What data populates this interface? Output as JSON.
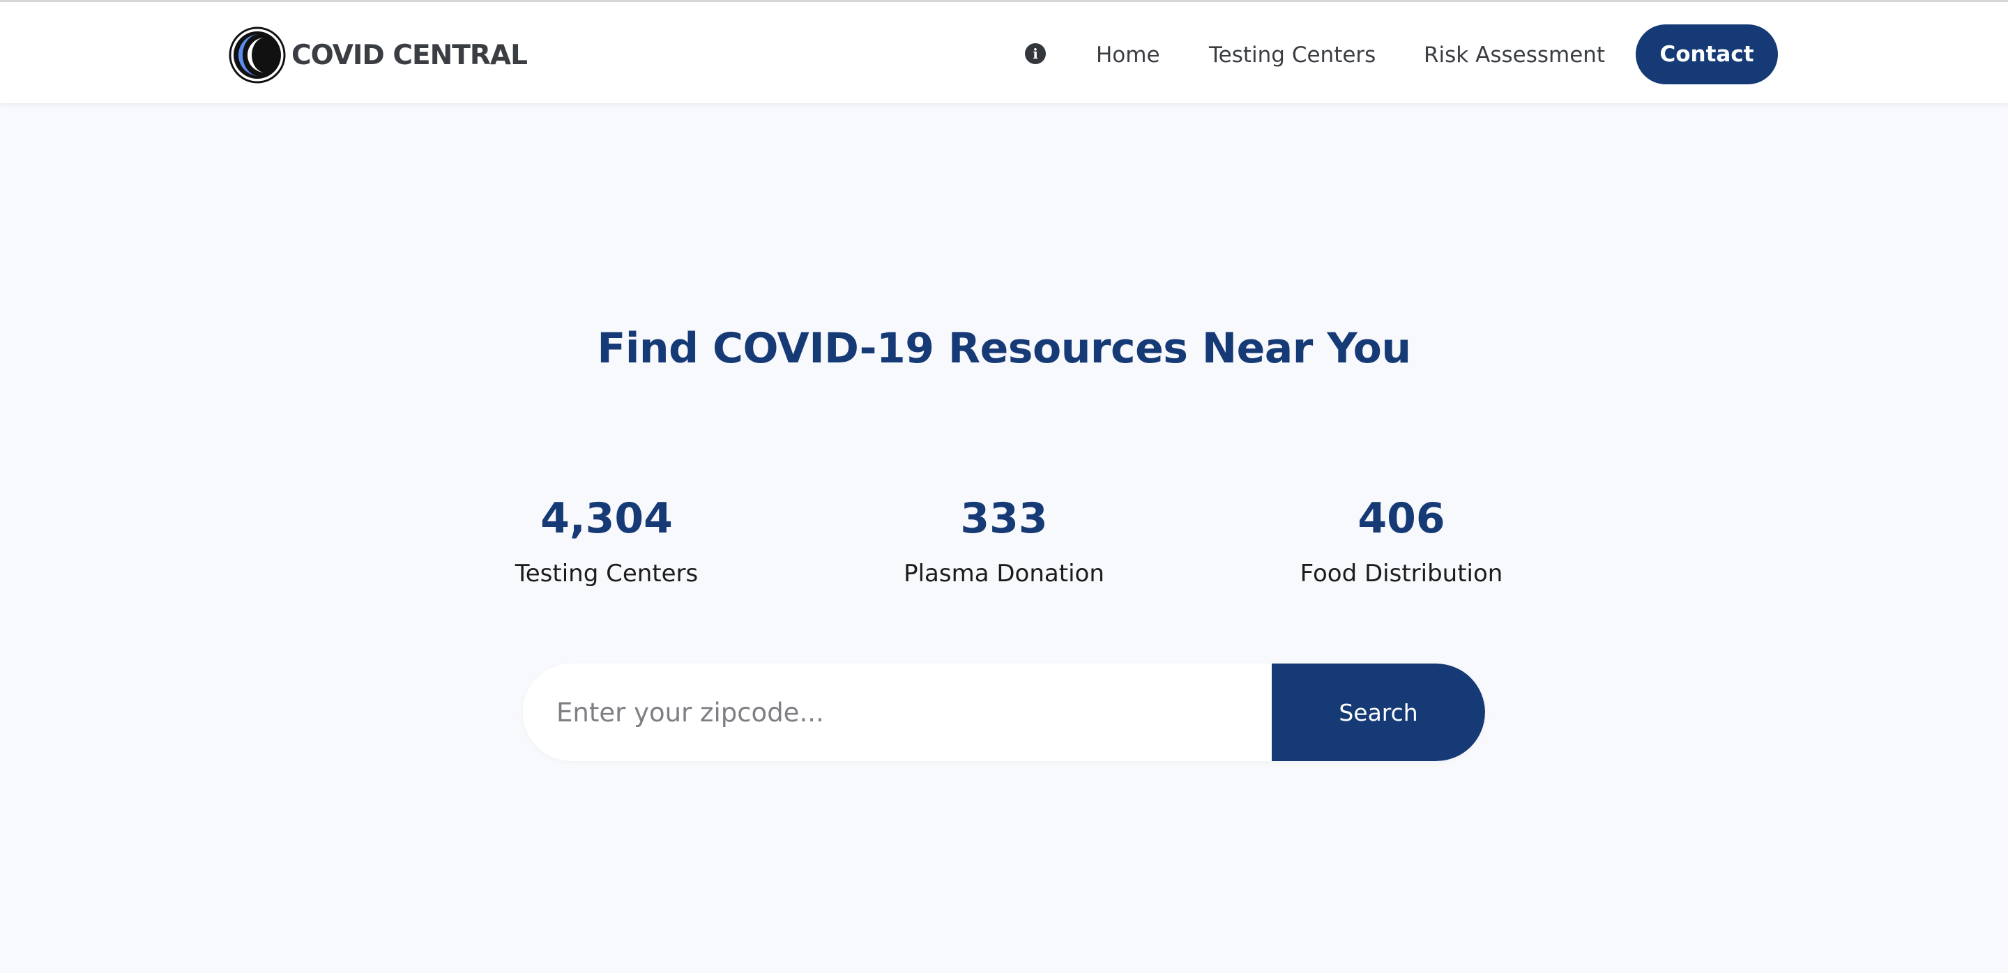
{
  "header": {
    "logo_text": "COVID CENTRAL",
    "nav": {
      "home": "Home",
      "testing_centers": "Testing Centers",
      "risk_assessment": "Risk Assessment",
      "contact": "Contact"
    },
    "info_icon": "info-circle-icon"
  },
  "hero": {
    "title": "Find COVID-19 Resources Near You"
  },
  "stats": [
    {
      "value": "4,304",
      "label": "Testing Centers"
    },
    {
      "value": "333",
      "label": "Plasma Donation"
    },
    {
      "value": "406",
      "label": "Food Distribution"
    }
  ],
  "search": {
    "placeholder": "Enter your zipcode...",
    "value": "",
    "button_label": "Search"
  },
  "colors": {
    "brand": "#163a75",
    "background": "#f8f9fc",
    "logo_blue": "#5b8ef0"
  }
}
